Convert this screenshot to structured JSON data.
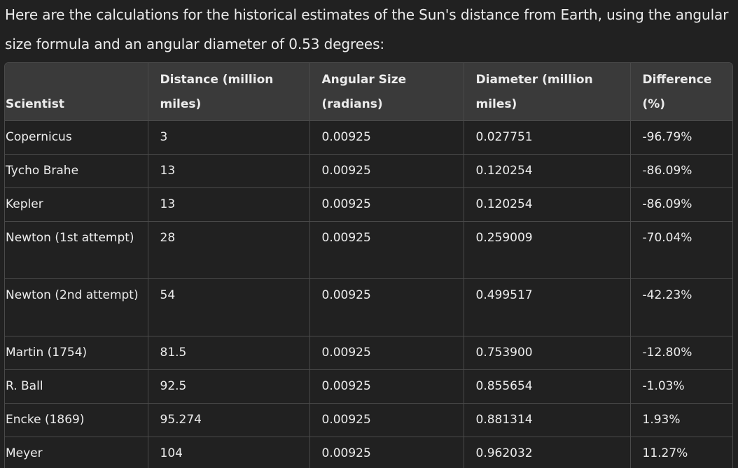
{
  "intro_text": "Here are the calculations for the historical estimates of the Sun's distance from Earth, using the angular size formula and an angular diameter of 0.53 degrees:",
  "table": {
    "headers": [
      "Scientist",
      "Distance (million miles)",
      "Angular Size (radians)",
      "Diameter (million miles)",
      "Difference (%)"
    ],
    "rows": [
      [
        "Copernicus",
        "3",
        "0.00925",
        "0.027751",
        "-96.79%"
      ],
      [
        "Tycho Brahe",
        "13",
        "0.00925",
        "0.120254",
        "-86.09%"
      ],
      [
        "Kepler",
        "13",
        "0.00925",
        "0.120254",
        "-86.09%"
      ],
      [
        "Newton (1st attempt)",
        "28",
        "0.00925",
        "0.259009",
        "-70.04%"
      ],
      [
        "Newton (2nd attempt)",
        "54",
        "0.00925",
        "0.499517",
        "-42.23%"
      ],
      [
        "Martin (1754)",
        "81.5",
        "0.00925",
        "0.753900",
        "-12.80%"
      ],
      [
        "R. Ball",
        "92.5",
        "0.00925",
        "0.855654",
        "-1.03%"
      ],
      [
        "Encke (1869)",
        "95.274",
        "0.00925",
        "0.881314",
        "1.93%"
      ],
      [
        "Meyer",
        "104",
        "0.00925",
        "0.962032",
        "11.27%"
      ]
    ]
  },
  "colors": {
    "background": "#212121",
    "header_background": "#3a3a3a",
    "border": "#4a4a4a",
    "text": "#ececec"
  }
}
